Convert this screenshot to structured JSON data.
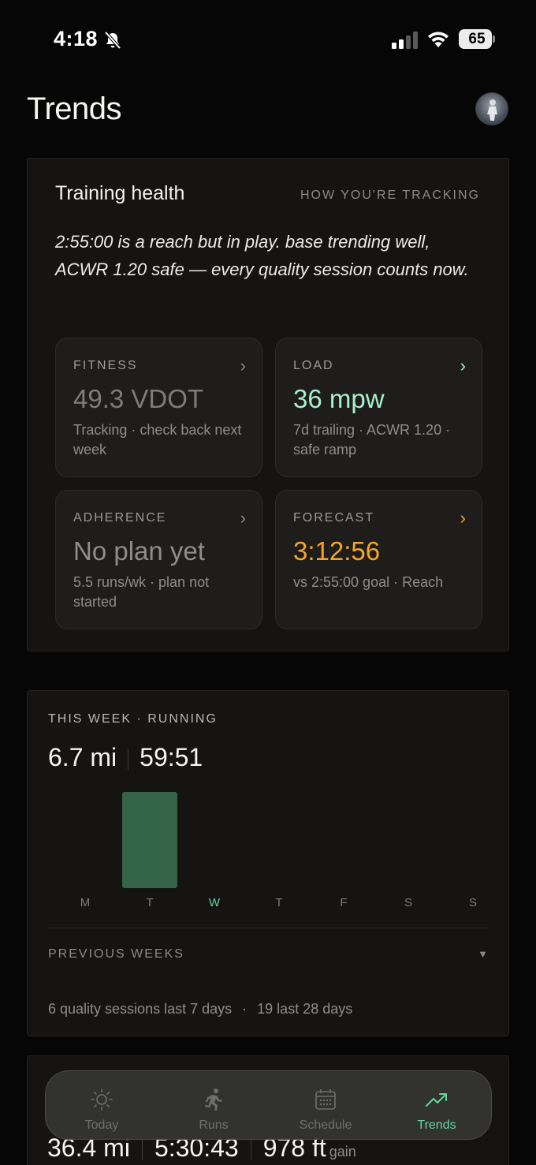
{
  "status_bar": {
    "time": "4:18",
    "battery": "65"
  },
  "header": {
    "title": "Trends"
  },
  "training_health": {
    "title": "Training health",
    "link_label": "HOW YOU'RE TRACKING",
    "summary": "2:55:00 is a reach but in play. base trending well, ACWR 1.20 safe — every quality session counts now.",
    "tiles": [
      {
        "label": "FITNESS",
        "value": "49.3 VDOT",
        "sub": "Tracking · check back next week",
        "accent": "#7d7c77",
        "chevron_color": "#8b8a85"
      },
      {
        "label": "LOAD",
        "value": "36 mpw",
        "sub": "7d trailing · ACWR 1.20 · safe ramp",
        "accent": "#a8efce",
        "chevron_color": "#a8efce"
      },
      {
        "label": "ADHERENCE",
        "value": "No plan yet",
        "sub": "5.5 runs/wk · plan not started",
        "accent": "#8e8d88",
        "chevron_color": "#8b8a85"
      },
      {
        "label": "FORECAST",
        "value": "3:12:56",
        "sub": "vs 2:55:00 goal · Reach",
        "accent": "#f5a623",
        "chevron_color": "#f5a623"
      }
    ]
  },
  "this_week": {
    "label": "THIS WEEK · RUNNING",
    "distance": "6.7 mi",
    "duration": "59:51",
    "previous_weeks_label": "PREVIOUS WEEKS",
    "quality_text": "6 quality sessions last 7 days",
    "quality_text_28": "19 last 28 days",
    "separator": "·"
  },
  "chart_data": {
    "type": "bar",
    "categories": [
      "M",
      "T",
      "W",
      "T",
      "F",
      "S",
      "S"
    ],
    "values": [
      0,
      6.7,
      0,
      0,
      0,
      0,
      0
    ],
    "ylim": [
      0,
      6.7
    ],
    "highlight_category_index": 2,
    "bar_color": "#356548",
    "highlight_label_color": "#6fcf9d"
  },
  "totals": {
    "distance": "36.4 mi",
    "duration": "5:30:43",
    "elevation": "978 ft",
    "elevation_unit": "gain"
  },
  "tab_bar": {
    "tabs": [
      {
        "label": "Today",
        "icon": "sun-icon"
      },
      {
        "label": "Runs",
        "icon": "runner-icon"
      },
      {
        "label": "Schedule",
        "icon": "calendar-icon"
      },
      {
        "label": "Trends",
        "icon": "trend-up-icon",
        "active": true
      }
    ]
  }
}
